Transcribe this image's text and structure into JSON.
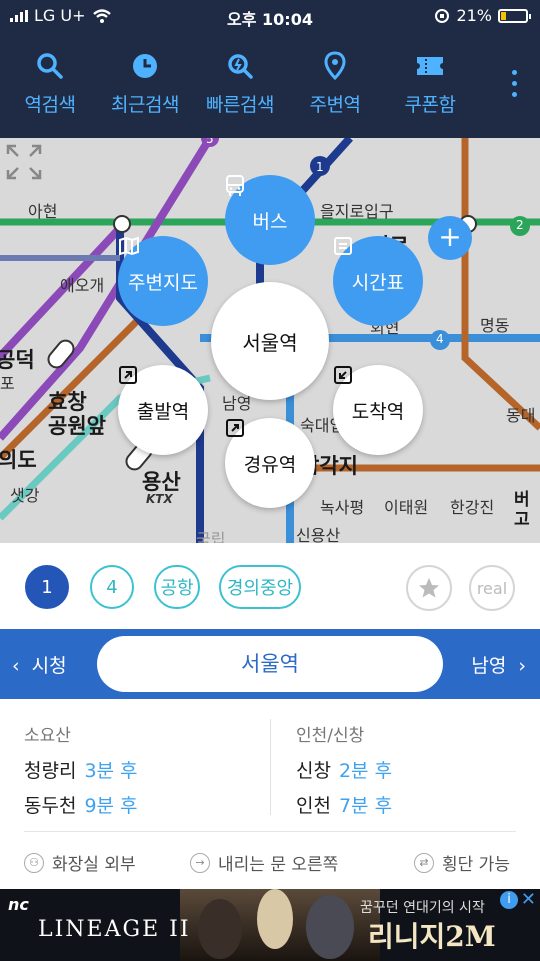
{
  "status": {
    "carrier": "LG U+",
    "time": "오후 10:04",
    "battery": "21%",
    "battery_level": 0.21
  },
  "nav": {
    "items": [
      {
        "label": "역검색",
        "icon": "search-icon"
      },
      {
        "label": "최근검색",
        "icon": "clock-icon"
      },
      {
        "label": "빠른검색",
        "icon": "quick-search-icon"
      },
      {
        "label": "주변역",
        "icon": "location-pin-icon"
      },
      {
        "label": "쿠폰함",
        "icon": "ticket-icon"
      }
    ]
  },
  "map": {
    "labels": {
      "ahyeon": "아현",
      "euljiro": "을지로입구",
      "aeogae": "애오개",
      "gongdeok": "공덕",
      "hyochang": "효창\n공원앞",
      "yongsan": "용산",
      "ktx": "KTX",
      "namyeong_map": "남영",
      "sookdae": "숙대입",
      "samgakji": "삼각지",
      "noksapyeong": "녹사평",
      "itaewon": "이태원",
      "hangangjin": "한강진",
      "myeongdong": "명동",
      "dongdae": "동대",
      "sinyongsan": "신용산",
      "gukrip": "국립",
      "saetgang": "샛강",
      "heo": "회현",
      "jiro": "지로",
      "ui": "의도",
      "po": "포",
      "beo": "버\n고"
    },
    "line_badges": [
      "5",
      "1",
      "2",
      "4"
    ]
  },
  "bubbles": {
    "bus": "버스",
    "map": "주변지도",
    "timetable": "시간표",
    "station": "서울역",
    "departure": "출발역",
    "arrival": "도착역",
    "via": "경유역"
  },
  "lines": {
    "chips": [
      "1",
      "4",
      "공항",
      "경의중앙"
    ],
    "active": "1",
    "favorite_icon": "star-icon",
    "real": "real"
  },
  "station": {
    "prev": "시청",
    "current": "서울역",
    "next": "남영"
  },
  "arrivals": {
    "left": {
      "direction": "소요산",
      "rows": [
        {
          "dest": "청량리",
          "time": "3분 후"
        },
        {
          "dest": "동두천",
          "time": "9분 후"
        }
      ]
    },
    "right": {
      "direction": "인천/신창",
      "rows": [
        {
          "dest": "신창",
          "time": "2분 후"
        },
        {
          "dest": "인천",
          "time": "7분 후"
        }
      ]
    }
  },
  "facilities": {
    "restroom": "화장실 외부",
    "door": "내리는 문 오른쪽",
    "crossing": "횡단 가능"
  },
  "ad": {
    "brand": "nc",
    "logo": "LINEAGE II",
    "tagline": "꿈꾸던 연대기의 시작",
    "name": "리니지2M",
    "info": "i",
    "close": "✕"
  },
  "colors": {
    "header": "#1f2b45",
    "accent": "#3f9cf0",
    "line1": "#2456b8",
    "stationbar": "#2c6ac8"
  }
}
